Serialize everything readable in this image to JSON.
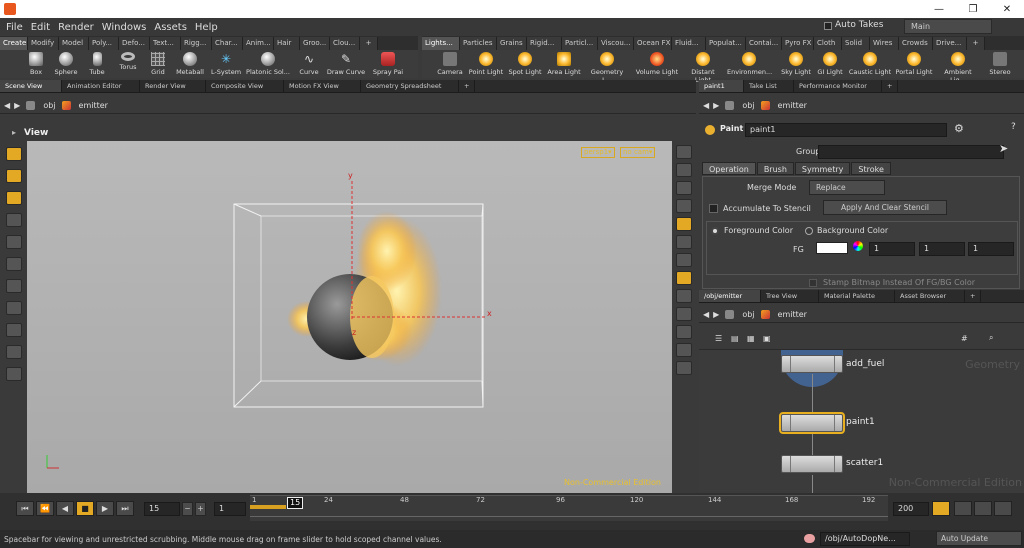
{
  "menubar": {
    "items": [
      "File",
      "Edit",
      "Render",
      "Windows",
      "Assets",
      "Help"
    ],
    "auto_takes": "Auto Takes",
    "takes_value": "Main"
  },
  "shelf_left": {
    "tabs": [
      "Create",
      "Modify",
      "Model",
      "Poly...",
      "Defo...",
      "Text...",
      "Rigg...",
      "Char...",
      "Anim...",
      "Hair",
      "Groo...",
      "Clou..."
    ],
    "tools": [
      "Box",
      "Sphere",
      "Tube",
      "Torus",
      "Grid",
      "Metaball",
      "L-System",
      "Platonic Sol...",
      "Curve",
      "Draw Curve",
      "Spray Pai"
    ]
  },
  "shelf_right": {
    "tabs": [
      "Lights...",
      "Particles",
      "Grains",
      "Rigid...",
      "Particl...",
      "Viscou...",
      "Ocean FX",
      "Fluid...",
      "Populat...",
      "Contai...",
      "Pyro FX",
      "Cloth",
      "Solid",
      "Wires",
      "Crowds",
      "Drive..."
    ],
    "tools": [
      "Camera",
      "Point Light",
      "Spot Light",
      "Area Light",
      "Geometry L...",
      "Volume Light",
      "Distant Light",
      "Environmen...",
      "Sky Light",
      "GI Light",
      "Caustic Light",
      "Portal Light",
      "Ambient Lig...",
      "Stereo"
    ]
  },
  "left_pane": {
    "tabs": [
      "Scene View",
      "Animation Editor",
      "Render View",
      "Composite View",
      "Motion FX View",
      "Geometry Spreadsheet"
    ],
    "path": [
      "obj",
      "emitter"
    ],
    "view_title": "View",
    "persp": "persp1▾",
    "cam": "no cam▾",
    "watermark": "Non-Commercial Edition",
    "axes": {
      "x": "x",
      "y": "y",
      "z": "z"
    }
  },
  "param_pane": {
    "tabs": [
      "paint1",
      "Take List",
      "Performance Monitor"
    ],
    "path": [
      "obj",
      "emitter"
    ],
    "node_type": "Paint",
    "node_name": "paint1",
    "group_label": "Group",
    "subtabs": [
      "Operation",
      "Brush",
      "Symmetry",
      "Stroke"
    ],
    "merge_mode_label": "Merge Mode",
    "merge_mode_value": "Replace",
    "accumulate_label": "Accumulate To Stencil",
    "apply_clear": "Apply And Clear Stencil",
    "fg_label": "Foreground Color",
    "bg_label": "Background Color",
    "fg": "FG",
    "fg_values": [
      "1",
      "1",
      "1"
    ],
    "stamp_label": "Stamp Bitmap Instead Of FG/BG Color"
  },
  "net_pane": {
    "tabs": [
      "/obj/emitter",
      "Tree View",
      "Material Palette",
      "Asset Browser"
    ],
    "path": [
      "obj",
      "emitter"
    ],
    "nodes": [
      "add_fuel",
      "paint1",
      "scatter1"
    ],
    "context": "Geometry",
    "watermark": "Non-Commercial Edition"
  },
  "timeline": {
    "current_frame": "15",
    "step": "1",
    "ticks": [
      "1",
      "24",
      "48",
      "72",
      "96",
      "120",
      "144",
      "168",
      "192"
    ],
    "marker": "15",
    "end_frame": "200"
  },
  "status": {
    "message": "Spacebar for viewing and unrestricted scrubbing. Middle mouse drag on frame slider to hold scoped channel values.",
    "path": "/obj/AutoDopNe...",
    "update_mode": "Auto Update"
  }
}
